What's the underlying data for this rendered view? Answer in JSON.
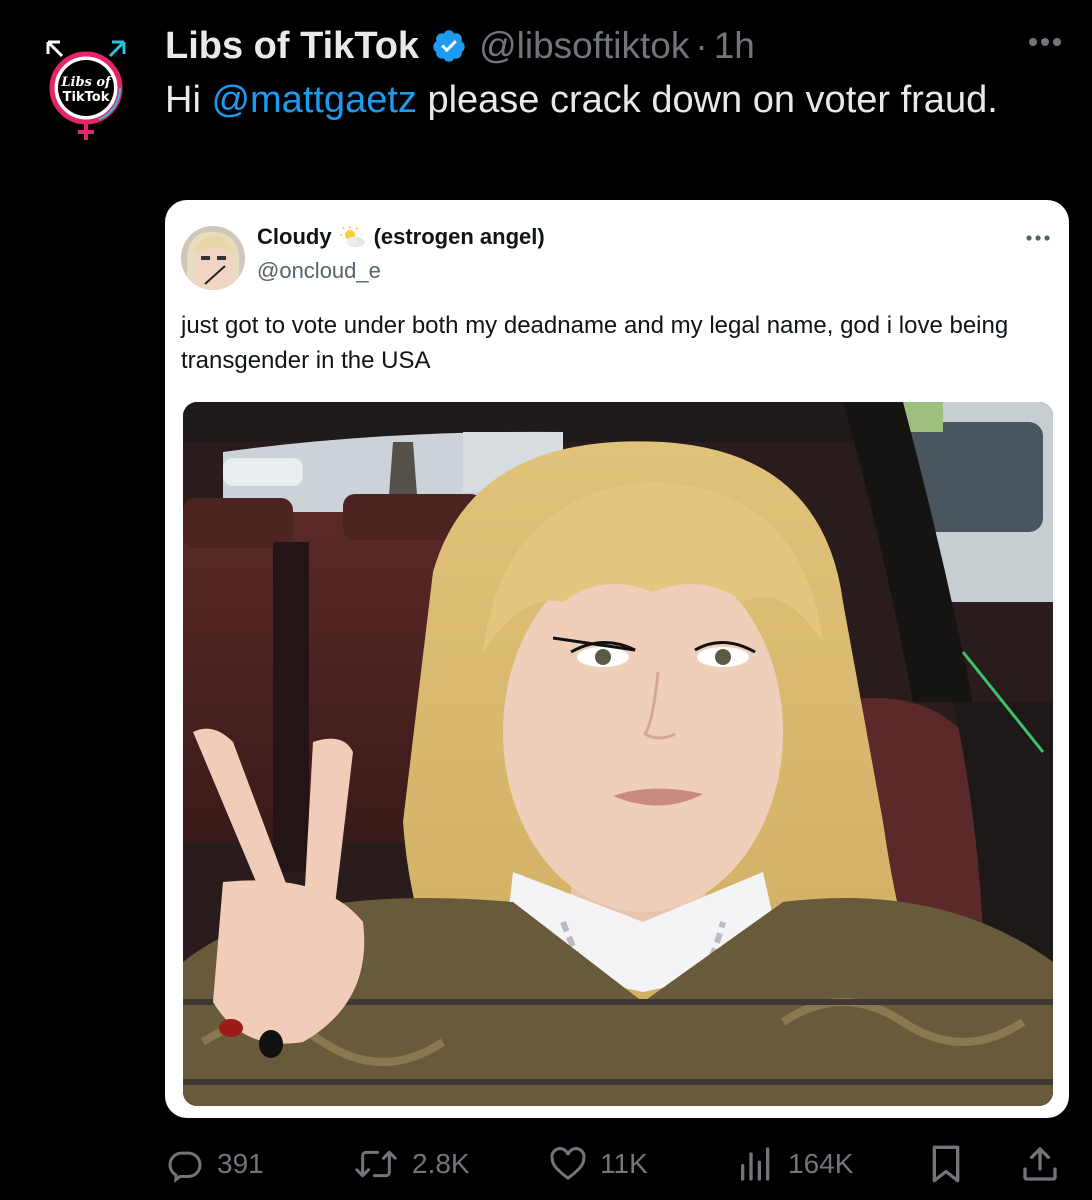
{
  "author": {
    "display_name": "Libs of TikTok",
    "handle": "@libsoftiktok",
    "separator": "·",
    "time": "1h",
    "avatar_text_line1": "Libs of",
    "avatar_text_line2": "TikTok"
  },
  "tweet": {
    "text_prefix": "Hi ",
    "mention": "@mattgaetz",
    "text_suffix": " please crack down on voter fraud."
  },
  "quoted": {
    "display_name": "Cloudy",
    "display_name_suffix": "(estrogen angel)",
    "handle": "@oncloud_e",
    "text": "just got to vote under both my deadname and my legal name, god i love being transgender in the USA"
  },
  "actions": {
    "replies": "391",
    "reposts": "2.8K",
    "likes": "11K",
    "views": "164K"
  },
  "colors": {
    "background": "#000000",
    "link": "#1d9bf0",
    "muted": "#71767b",
    "verified": "#1d9bf0"
  }
}
